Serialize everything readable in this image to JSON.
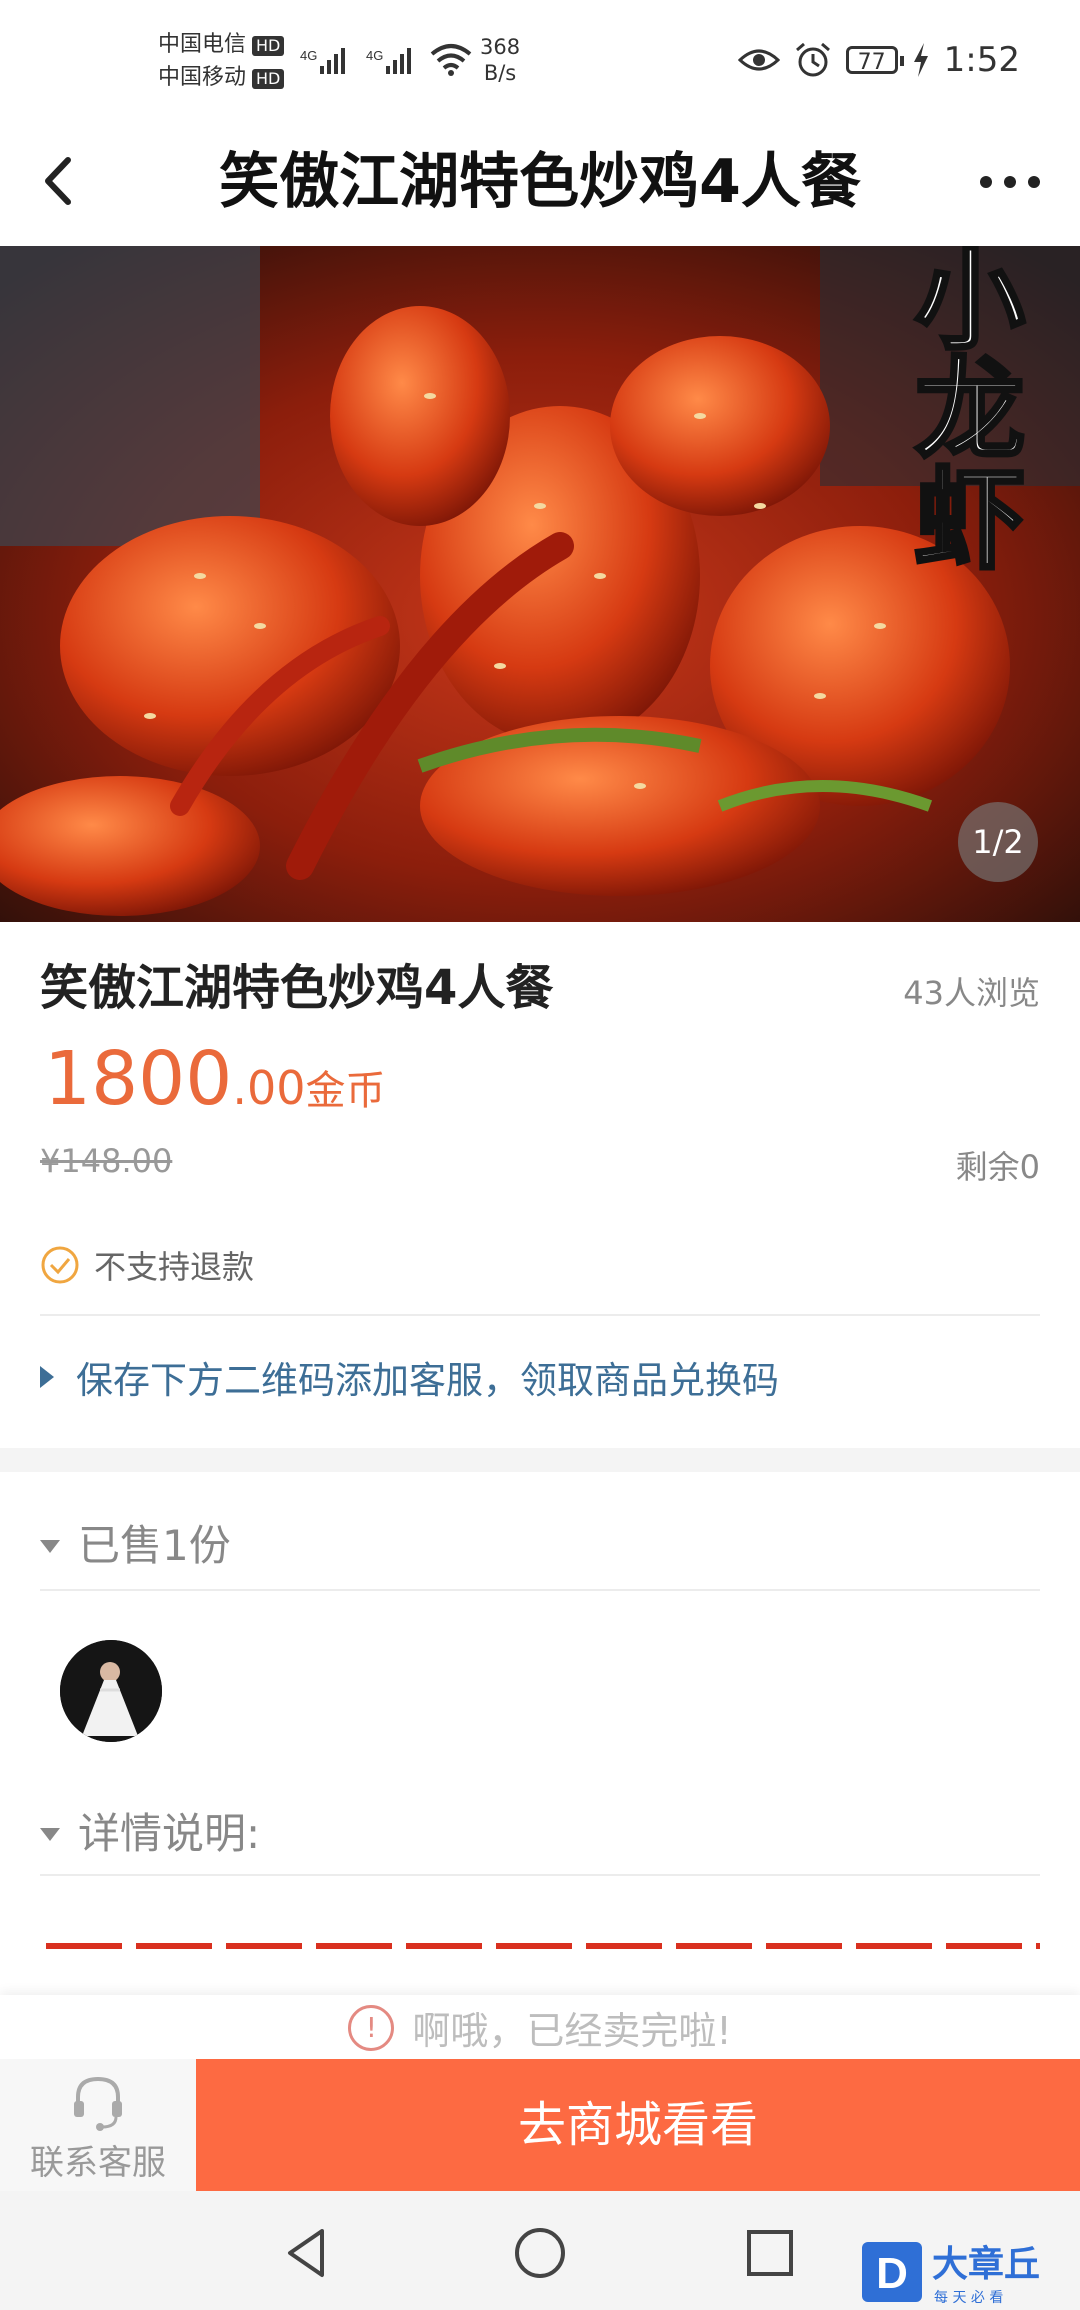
{
  "status_bar": {
    "carrier1": "中国电信",
    "carrier2": "中国移动",
    "hd_badge": "HD",
    "net_type": "4G",
    "speed_value": "368",
    "speed_unit": "B/s",
    "battery": "77",
    "time": "1:52"
  },
  "header": {
    "title": "笑傲江湖特色炒鸡4人餐"
  },
  "hero": {
    "overlay_text": "小龙虾",
    "counter": "1/2"
  },
  "product": {
    "title": "笑傲江湖特色炒鸡4人餐",
    "views": "43人浏览",
    "price_int": "1800",
    "price_dec": ".00",
    "price_unit": "金币",
    "original_price": "¥148.00",
    "remaining": "剩余0",
    "refund_policy": "不支持退款",
    "notice": "保存下方二维码添加客服，领取商品兑换码"
  },
  "sold_section": {
    "label": "已售1份"
  },
  "detail_section": {
    "label": "详情说明:"
  },
  "sold_out_message": "啊哦，已经卖完啦!",
  "bottom_bar": {
    "service_label": "联系客服",
    "shop_label": "去商城看看"
  },
  "watermark": {
    "brand": "大章丘",
    "slogan": "每 天 必 看"
  },
  "colors": {
    "accent": "#fd6a42",
    "price": "#ea6a3b",
    "link": "#3d6e96"
  }
}
